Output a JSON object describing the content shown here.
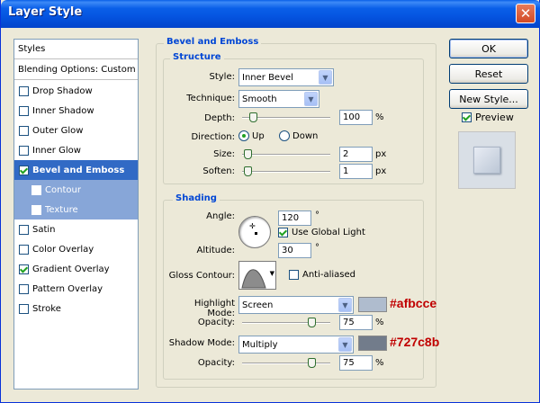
{
  "window": {
    "title": "Layer Style",
    "close_glyph": "✕"
  },
  "styles_list": {
    "header": "Styles",
    "blending": "Blending Options: Custom",
    "items": [
      {
        "label": "Drop Shadow",
        "checked": false
      },
      {
        "label": "Inner Shadow",
        "checked": false
      },
      {
        "label": "Outer Glow",
        "checked": false
      },
      {
        "label": "Inner Glow",
        "checked": false
      },
      {
        "label": "Bevel and Emboss",
        "checked": true
      },
      {
        "label": "Contour",
        "checked": false
      },
      {
        "label": "Texture",
        "checked": false
      },
      {
        "label": "Satin",
        "checked": false
      },
      {
        "label": "Color Overlay",
        "checked": false
      },
      {
        "label": "Gradient Overlay",
        "checked": true
      },
      {
        "label": "Pattern Overlay",
        "checked": false
      },
      {
        "label": "Stroke",
        "checked": false
      }
    ]
  },
  "buttons": {
    "ok": "OK",
    "reset": "Reset",
    "new_style": "New Style...",
    "preview": "Preview"
  },
  "bevel": {
    "title": "Bevel and Emboss",
    "structure_title": "Structure",
    "style_label": "Style:",
    "style_value": "Inner Bevel",
    "technique_label": "Technique:",
    "technique_value": "Smooth",
    "depth_label": "Depth:",
    "depth_value": "100",
    "depth_unit": "%",
    "direction_label": "Direction:",
    "dir_up": "Up",
    "dir_down": "Down",
    "size_label": "Size:",
    "size_value": "2",
    "size_unit": "px",
    "soften_label": "Soften:",
    "soften_value": "1",
    "soften_unit": "px"
  },
  "shading": {
    "title": "Shading",
    "angle_label": "Angle:",
    "angle_value": "120",
    "angle_unit": "°",
    "global_light": "Use Global Light",
    "altitude_label": "Altitude:",
    "altitude_value": "30",
    "altitude_unit": "°",
    "gloss_label": "Gloss Contour:",
    "antialiased": "Anti-aliased",
    "highlight_label": "Highlight Mode:",
    "highlight_mode": "Screen",
    "highlight_opacity_label": "Opacity:",
    "highlight_opacity": "75",
    "highlight_opacity_unit": "%",
    "shadow_label": "Shadow Mode:",
    "shadow_mode": "Multiply",
    "shadow_opacity_label": "Opacity:",
    "shadow_opacity": "75",
    "shadow_opacity_unit": "%"
  },
  "annotations": {
    "highlight_color": "#afbcce",
    "shadow_color": "#727c8b"
  },
  "colors": {
    "highlight_swatch": "#afbcce",
    "shadow_swatch": "#727c8b",
    "annotation_text": "#c00000"
  }
}
